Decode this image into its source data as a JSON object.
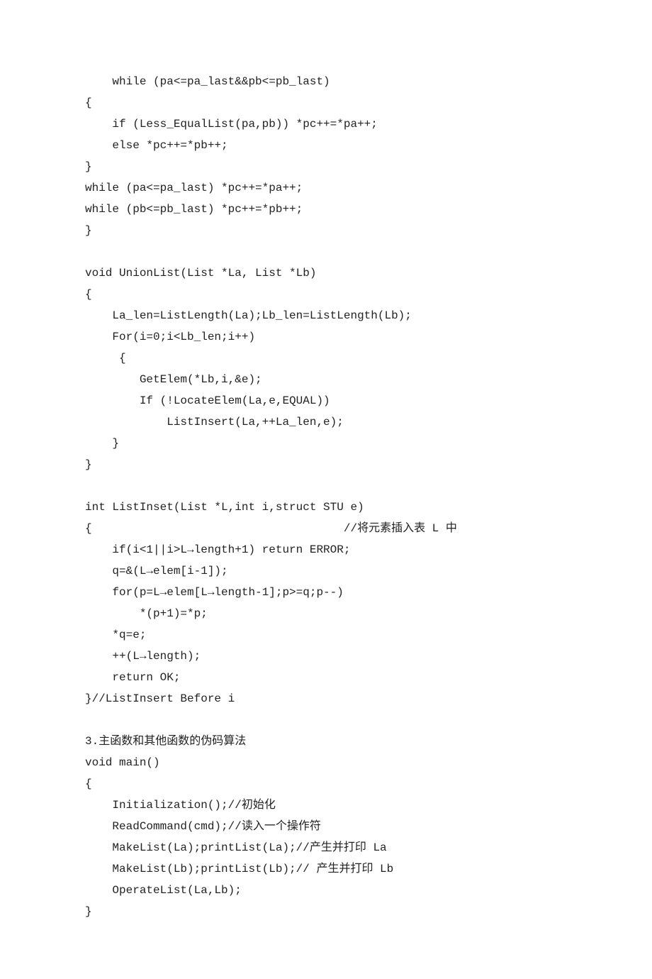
{
  "lines": [
    "    while (pa<=pa_last&&pb<=pb_last)",
    "{",
    "    if (Less_EqualList(pa,pb)) *pc++=*pa++;",
    "    else *pc++=*pb++;",
    "}",
    "while (pa<=pa_last) *pc++=*pa++;",
    "while (pb<=pb_last) *pc++=*pb++;",
    "}",
    "",
    "void UnionList(List *La, List *Lb)",
    "{",
    "    La_len=ListLength(La);Lb_len=ListLength(Lb);",
    "    For(i=0;i<Lb_len;i++)",
    "     {",
    "        GetElem(*Lb,i,&e);",
    "        If (!LocateElem(La,e,EQUAL))",
    "            ListInsert(La,++La_len,e);",
    "    }",
    "}",
    "",
    "int ListInset(List *L,int i,struct STU e)",
    "{                                     //将元素插入表 L 中",
    "    if(i<1||i>L→length+1) return ERROR;",
    "    q=&(L→elem[i-1]);",
    "    for(p=L→elem[L→length-1];p>=q;p--)",
    "        *(p+1)=*p;",
    "    *q=e;",
    "    ++(L→length);",
    "    return OK;",
    "}//ListInsert Before i",
    "",
    "3.主函数和其他函数的伪码算法",
    "void main()",
    "{",
    "    Initialization();//初始化",
    "    ReadCommand(cmd);//读入一个操作符",
    "    MakeList(La);printList(La);//产生并打印 La",
    "    MakeList(Lb);printList(Lb);// 产生并打印 Lb",
    "    OperateList(La,Lb);",
    "}"
  ]
}
